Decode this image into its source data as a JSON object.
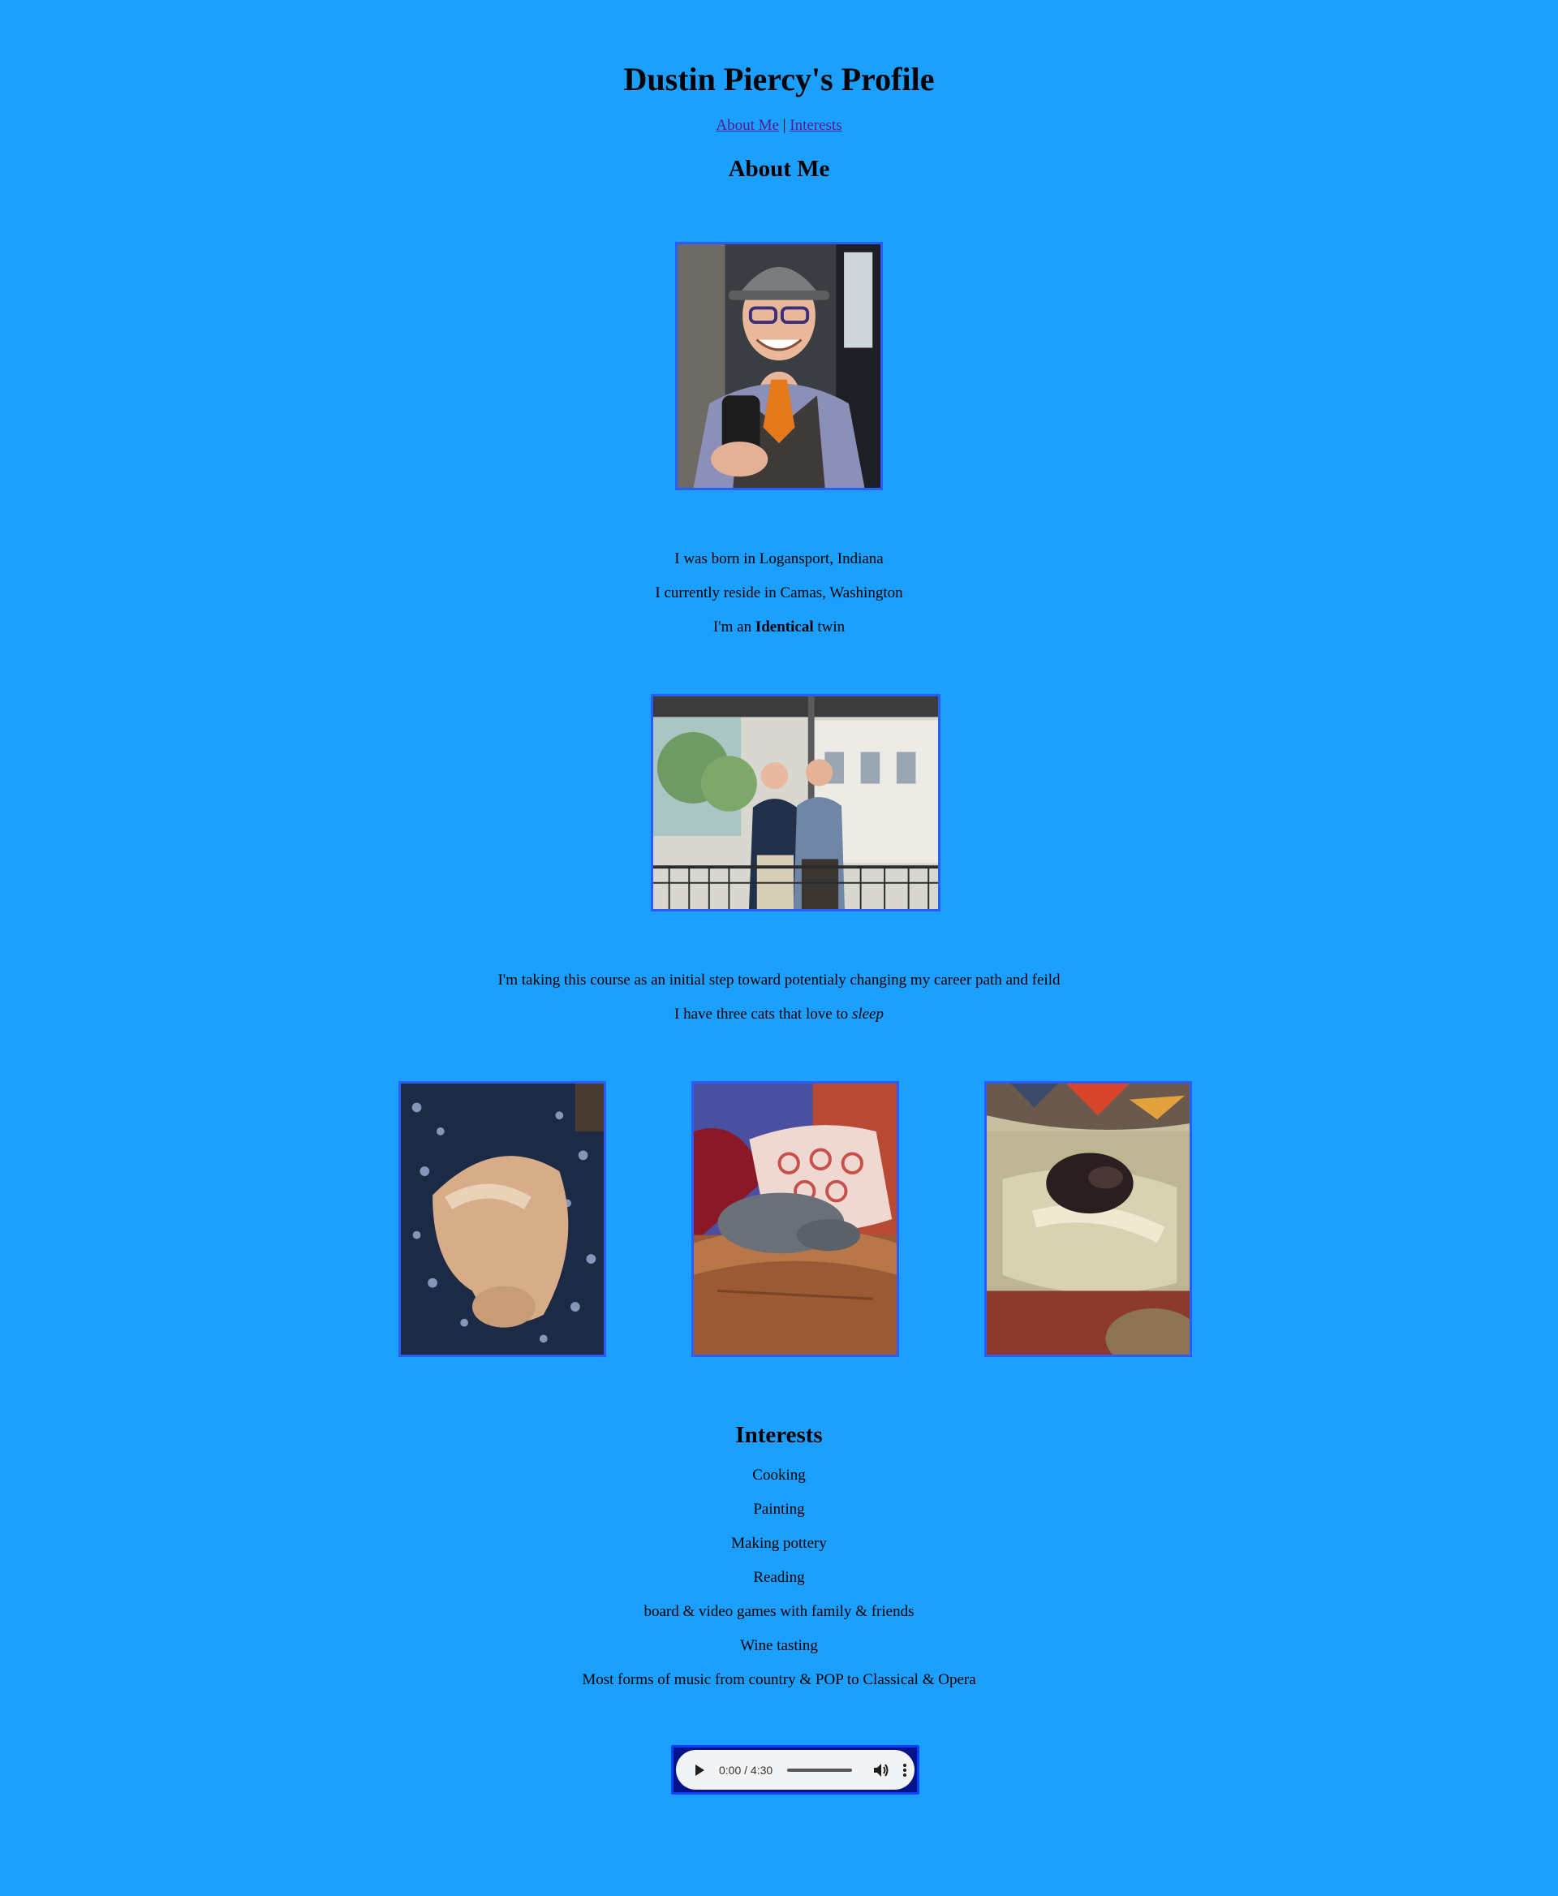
{
  "page": {
    "title": "Dustin Piercy's Profile"
  },
  "nav": {
    "about_label": "About Me",
    "separator": "|",
    "interests_label": "Interests"
  },
  "about": {
    "heading": "About Me",
    "facts": [
      "I was born in Logansport, Indiana",
      "I currently reside in Camas, Washington"
    ],
    "twin_prefix": "I'm an",
    "twin_bold": "Identical",
    "twin_suffix": "twin",
    "course_line": "I'm taking this course as an initial step toward potentialy changing my career path and feild",
    "cats_prefix": "I have three cats that love to",
    "cats_italic": "sleep"
  },
  "interests": {
    "heading": "Interests",
    "items": [
      "Cooking",
      "Painting",
      "Making pottery",
      "Reading",
      "board & video games with family & friends",
      "Wine tasting",
      "Most forms of music from country & POP to Classical & Opera"
    ]
  },
  "audio": {
    "time": "0:00 / 4:30"
  },
  "colors": {
    "background": "#1ba0ff",
    "image_border": "#2a5cff",
    "link": "#551a8b"
  },
  "icons": {
    "play": "play-icon",
    "volume": "volume-icon",
    "more": "more-options-icon"
  }
}
